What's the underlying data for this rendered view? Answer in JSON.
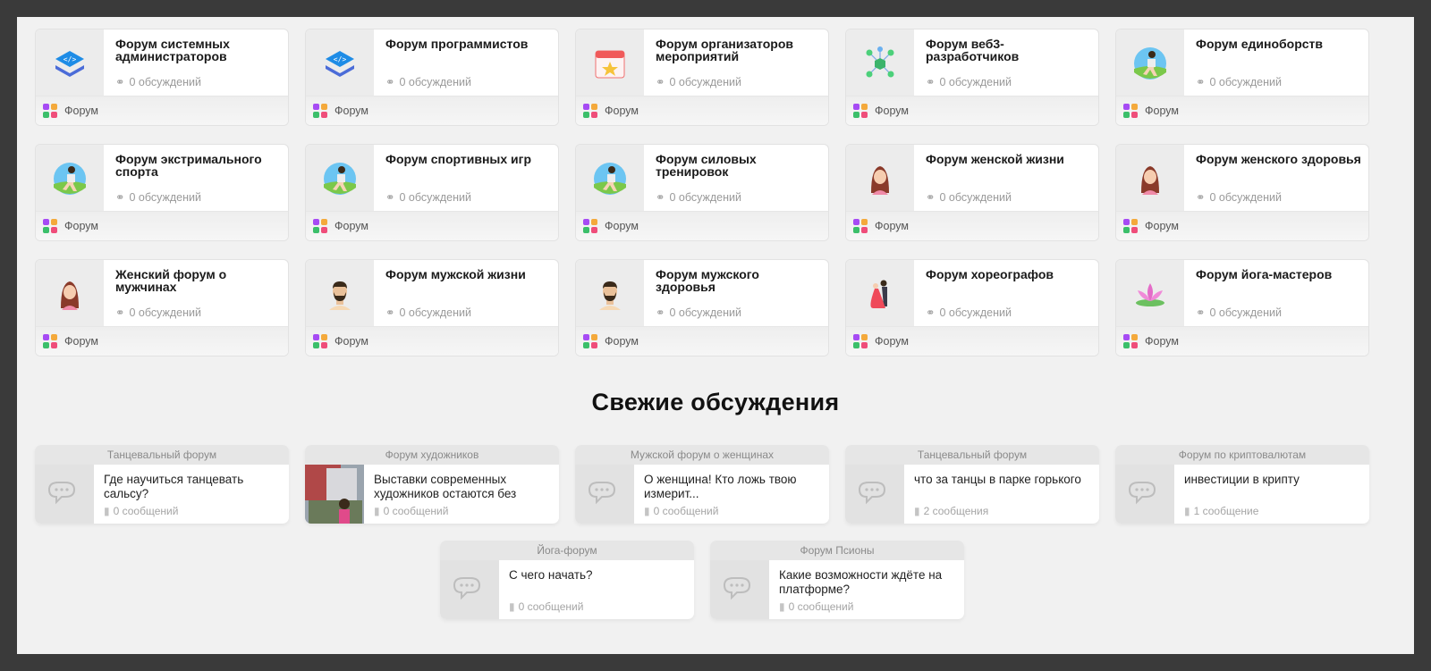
{
  "forums": [
    {
      "title": "Форум системных администраторов",
      "count": "0 обсуждений",
      "category": "Форум",
      "icon": "code-stack-icon"
    },
    {
      "title": "Форум программистов",
      "count": "0 обсуждений",
      "category": "Форум",
      "icon": "code-stack-icon"
    },
    {
      "title": "Форум организаторов мероприятий",
      "count": "0 обсуждений",
      "category": "Форум",
      "icon": "calendar-star-icon"
    },
    {
      "title": "Форум веб3-разработчиков",
      "count": "0 обсуждений",
      "category": "Форум",
      "icon": "network-cube-icon"
    },
    {
      "title": "Форум единоборств",
      "count": "0 обсуждений",
      "category": "Форум",
      "icon": "runner-icon"
    },
    {
      "title": "Форум экстримального спорта",
      "count": "0 обсуждений",
      "category": "Форум",
      "icon": "runner-icon"
    },
    {
      "title": "Форум спортивных игр",
      "count": "0 обсуждений",
      "category": "Форум",
      "icon": "runner-icon"
    },
    {
      "title": "Форум силовых тренировок",
      "count": "0 обсуждений",
      "category": "Форум",
      "icon": "runner-icon"
    },
    {
      "title": "Форум женской жизни",
      "count": "0 обсуждений",
      "category": "Форум",
      "icon": "woman-avatar-icon"
    },
    {
      "title": "Форум женского здоровья",
      "count": "0 обсуждений",
      "category": "Форум",
      "icon": "woman-avatar-icon"
    },
    {
      "title": "Женский форум о мужчинах",
      "count": "0 обсуждений",
      "category": "Форум",
      "icon": "woman-avatar-icon"
    },
    {
      "title": "Форум мужской жизни",
      "count": "0 обсуждений",
      "category": "Форум",
      "icon": "man-avatar-icon"
    },
    {
      "title": "Форум мужского здоровья",
      "count": "0 обсуждений",
      "category": "Форум",
      "icon": "man-avatar-icon"
    },
    {
      "title": "Форум хореографов",
      "count": "0 обсуждений",
      "category": "Форум",
      "icon": "dancers-icon"
    },
    {
      "title": "Форум йога-мастеров",
      "count": "0 обсуждений",
      "category": "Форум",
      "icon": "lotus-icon"
    }
  ],
  "section_title": "Свежие обсуждения",
  "discussions": [
    {
      "forum": "Танцевальный форум",
      "title": "Где научиться танцевать сальсу?",
      "count": "0 сообщений",
      "icon": "chat-bubbles-icon"
    },
    {
      "forum": "Форум художников",
      "title": "Выставки современных художников остаются без",
      "count": "0 сообщений",
      "icon": "exhibition-photo"
    },
    {
      "forum": "Мужской форум о женщинах",
      "title": "О женщина! Кто ложь твою измерит...",
      "count": "0 сообщений",
      "icon": "chat-bubbles-icon"
    },
    {
      "forum": "Танцевальный форум",
      "title": "что за танцы в парке горького",
      "count": "2 сообщения",
      "icon": "chat-bubbles-icon"
    },
    {
      "forum": "Форум по криптовалютам",
      "title": "инвестиции в крипту",
      "count": "1 сообщение",
      "icon": "chat-bubbles-icon"
    },
    {
      "forum": "Йога-форум",
      "title": "С чего начать?",
      "count": "0 сообщений",
      "icon": "chat-bubbles-icon"
    },
    {
      "forum": "Форум Псионы",
      "title": "Какие возможности ждёте на платформе?",
      "count": "0 сообщений",
      "icon": "chat-bubbles-icon"
    }
  ],
  "colors": {
    "page_bg": "#f1f1f1",
    "frame_bg": "#3a3a3a",
    "muted_text": "#9a9a9a"
  }
}
